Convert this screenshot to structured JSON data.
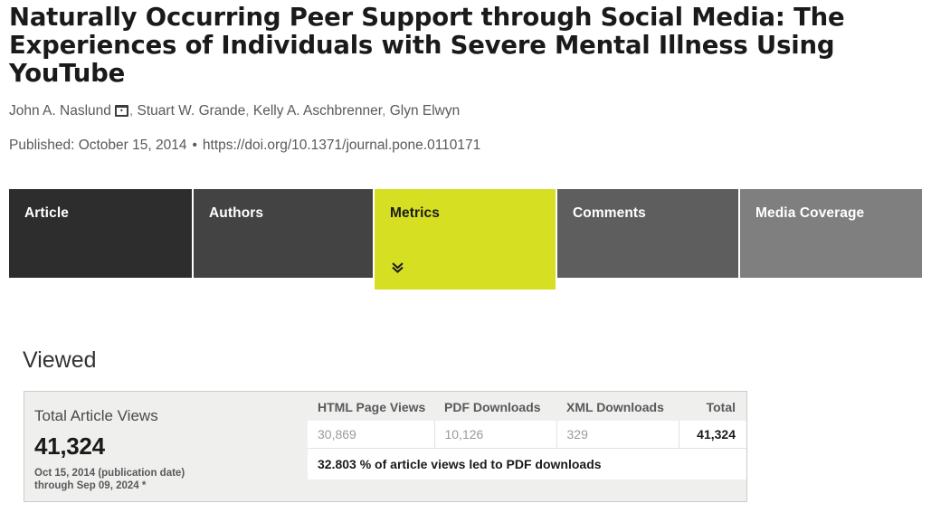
{
  "article": {
    "title": "Naturally Occurring Peer Support through Social Media: The Experiences of Individuals with Severe Mental Illness Using YouTube",
    "authors": [
      {
        "name": "John A. Naslund",
        "has_corresponding_icon": true
      },
      {
        "name": "Stuart W. Grande",
        "has_corresponding_icon": false
      },
      {
        "name": "Kelly A. Aschbrenner",
        "has_corresponding_icon": false
      },
      {
        "name": "Glyn Elwyn",
        "has_corresponding_icon": false
      }
    ],
    "published_label": "Published: October 15, 2014",
    "separator": "•",
    "doi": "https://doi.org/10.1371/journal.pone.0110171",
    "corresponding_author_icon": "envelope-icon"
  },
  "tabs": [
    {
      "label": "Article",
      "key": "article",
      "active": false,
      "color": "#2d2d2d"
    },
    {
      "label": "Authors",
      "key": "authors",
      "active": false,
      "color": "#434343"
    },
    {
      "label": "Metrics",
      "key": "metrics",
      "active": true,
      "color": "#d6df21"
    },
    {
      "label": "Comments",
      "key": "comments",
      "active": false,
      "color": "#5e5e5e"
    },
    {
      "label": "Media Coverage",
      "key": "media",
      "active": false,
      "color": "#7f7f7f"
    }
  ],
  "active_tab_indicator_icon": "double-chevron-down-icon",
  "viewed": {
    "heading": "Viewed",
    "summary": {
      "label": "Total Article Views",
      "value": "41,324",
      "date_range_line1": "Oct 15, 2014 (publication date)",
      "date_range_line2": "through Sep 09, 2024 *"
    },
    "table": {
      "headers": [
        "HTML Page Views",
        "PDF Downloads",
        "XML Downloads",
        "Total"
      ],
      "row": [
        "30,869",
        "10,126",
        "329",
        "41,324"
      ],
      "footnote": "32.803 % of article views led to PDF downloads"
    }
  },
  "colors": {
    "accent": "#d6df21",
    "panel_bg": "#efefee",
    "panel_border": "#cccccc",
    "muted_text": "#9a9a9a"
  }
}
